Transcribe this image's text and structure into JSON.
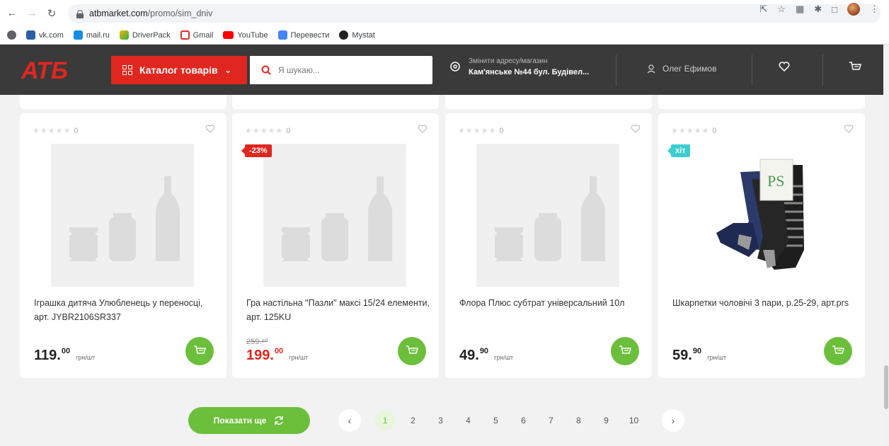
{
  "browser": {
    "url_host": "atbmarket.com",
    "url_path": "/promo/sim_dniv",
    "bookmarks": [
      "vk.com",
      "mail.ru",
      "DriverPack",
      "Gmail",
      "YouTube",
      "Перевести",
      "Mystat"
    ]
  },
  "header": {
    "logo": "АТБ",
    "catalog_label": "Каталог товарів",
    "search_placeholder": "Я шукаю...",
    "address_hint": "Змінити адресу/магазин",
    "address_value": "Кам'янське №44 бул. Будівел...",
    "user_name": "Олег Ефимов"
  },
  "products": [
    {
      "rating_count": "0",
      "title": "Іграшка дитяча Улюбленець у переносці, арт. JYBR2106SR337",
      "price_main": "119.",
      "price_cents": "00",
      "unit": "грн/шт"
    },
    {
      "rating_count": "0",
      "badge": "-23%",
      "title": "Гра настільна \"Пазли\" максі 15/24 елементи, арт. 125KU",
      "old_price": "259.⁹⁰",
      "price_main": "199.",
      "price_cents": "00",
      "unit": "грн/шт"
    },
    {
      "rating_count": "0",
      "title": "Флора Плюс субтрат універсальний 10л",
      "price_main": "49.",
      "price_cents": "90",
      "unit": "грн/шт"
    },
    {
      "rating_count": "0",
      "badge": "хіт",
      "title": "Шкарпетки чоловічі 3 пари, р.25-29, арт.prs",
      "price_main": "59.",
      "price_cents": "90",
      "unit": "грн/шт",
      "image_label": "PS"
    }
  ],
  "load_more_label": "Показати ще",
  "pagination": {
    "pages": [
      "1",
      "2",
      "3",
      "4",
      "5",
      "6",
      "7",
      "8",
      "9",
      "10"
    ],
    "active": "1",
    "prev": "‹",
    "next": "›"
  }
}
